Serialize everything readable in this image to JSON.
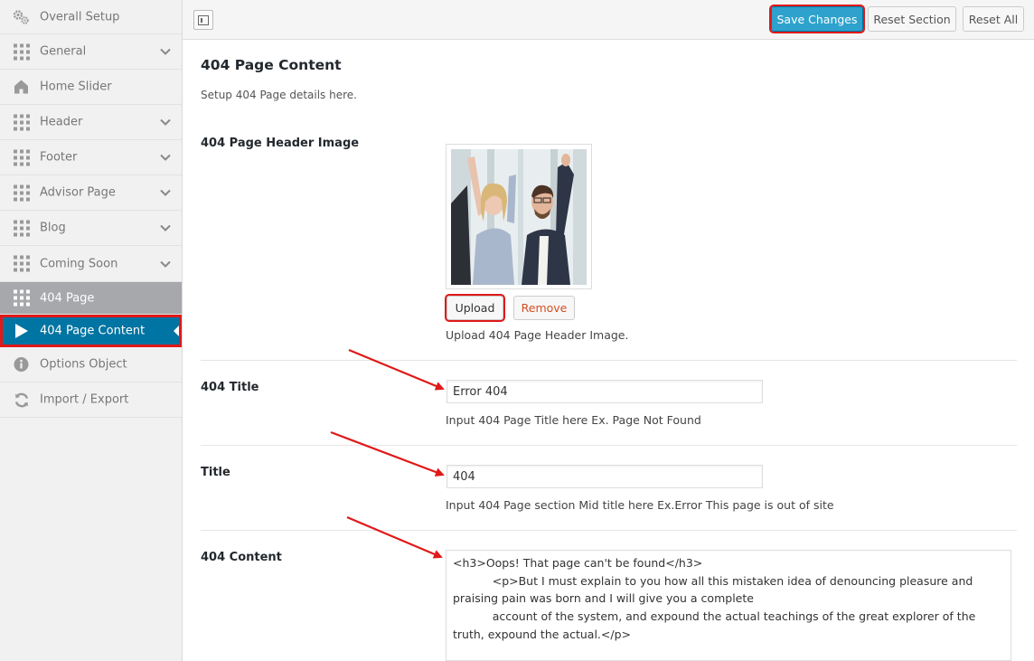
{
  "sidebar": {
    "items": [
      {
        "label": "Overall Setup",
        "icon": "gears-icon"
      },
      {
        "label": "General",
        "icon": "grid-icon"
      },
      {
        "label": "Home Slider",
        "icon": "home-icon"
      },
      {
        "label": "Header",
        "icon": "grid-icon"
      },
      {
        "label": "Footer",
        "icon": "grid-icon"
      },
      {
        "label": "Advisor Page",
        "icon": "grid-icon"
      },
      {
        "label": "Blog",
        "icon": "grid-icon"
      },
      {
        "label": "Coming Soon",
        "icon": "grid-icon"
      },
      {
        "label": "404 Page",
        "icon": "grid-icon"
      },
      {
        "label": "404 Page Content",
        "icon": "play-icon"
      },
      {
        "label": "Options Object",
        "icon": "info-icon"
      },
      {
        "label": "Import / Export",
        "icon": "refresh-icon"
      }
    ]
  },
  "toolbar": {
    "save_label": "Save Changes",
    "reset_section_label": "Reset Section",
    "reset_all_label": "Reset All"
  },
  "section": {
    "title": "404 Page Content",
    "description": "Setup 404 Page details here."
  },
  "fields": {
    "header_image": {
      "label": "404 Page Header Image",
      "upload_label": "Upload",
      "remove_label": "Remove",
      "description": "Upload 404 Page Header Image."
    },
    "page_title": {
      "label": "404 Title",
      "value": "Error 404",
      "description": "Input 404 Page Title here Ex. Page Not Found"
    },
    "mid_title": {
      "label": "Title",
      "value": "404",
      "description": "Input 404 Page section Mid title here Ex.Error This page is out of site"
    },
    "content": {
      "label": "404 Content",
      "value": "<h3>Oops! That page can't be found</h3>\n           <p>But I must explain to you how all this mistaken idea of denouncing pleasure and praising pain was born and I will give you a complete\n           account of the system, and expound the actual teachings of the great explorer of the truth, expound the actual.</p>"
    }
  },
  "colors": {
    "active_nav": "#0074a2",
    "primary_button": "#2ea2cc",
    "highlight": "#e01919",
    "remove_text": "#d54e21"
  }
}
